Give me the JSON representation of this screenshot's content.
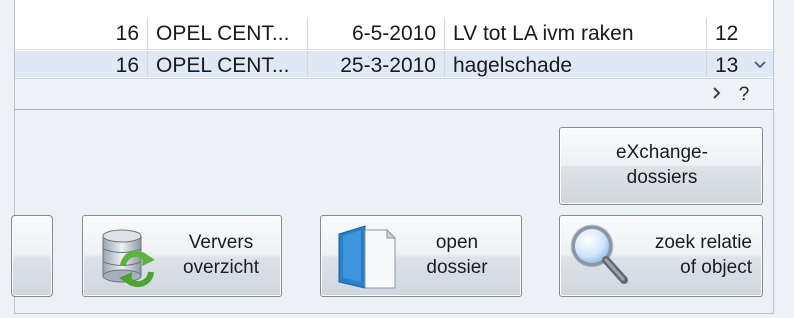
{
  "grid": {
    "rows": [
      {
        "num": "16",
        "name": "OPEL CENT...",
        "date": "6-5-2010",
        "description": "LV tot LA ivm raken",
        "extra": "12"
      },
      {
        "num": "16",
        "name": "OPEL CENT...",
        "date": "25-3-2010",
        "description": "hagelschade",
        "extra": "13"
      }
    ],
    "scroll_down_icon": "chevron-down-icon",
    "scroll_right_icon": "chevron-right-icon",
    "corner_label": "?"
  },
  "buttons": {
    "refresh": {
      "line1": "Ververs",
      "line2": "overzicht",
      "icon": "database-refresh-icon"
    },
    "open_dossier": {
      "line1": "open",
      "line2": "dossier",
      "icon": "document-icon"
    },
    "search": {
      "line1": "zoek relatie",
      "line2": "of object",
      "icon": "magnifier-icon"
    },
    "exchange": {
      "line1": "eXchange-",
      "line2": "dossiers"
    }
  },
  "colors": {
    "selected_row": "#dfe9f6",
    "button_border": "#7f8b99",
    "refresh_arrows": "#5bb43c",
    "open_icon_blue": "#2b7fc8"
  }
}
